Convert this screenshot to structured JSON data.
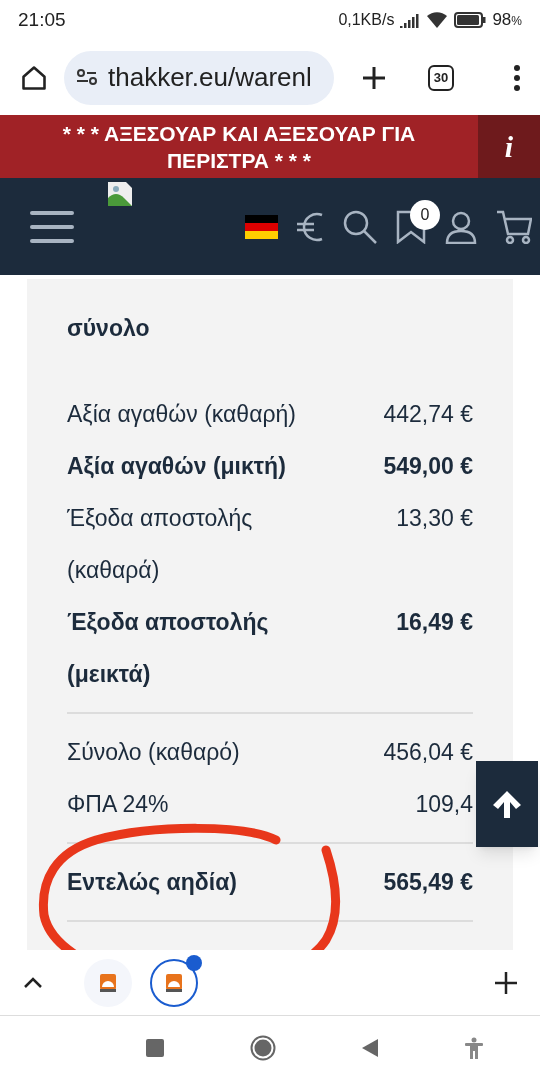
{
  "status_bar": {
    "time": "21:05",
    "speed": "0,1KB/s",
    "battery": "98",
    "battery_unit": "%"
  },
  "browser": {
    "url": "thakker.eu/warenl",
    "tab_count": "30"
  },
  "banner": {
    "text": "* * * ΑΞΕΣΟΥΑΡ ΚΑΙ ΑΞΕΣΟΥΑΡ ΓΙΑ ΠΕΡΙΣΤΡΑ * * *",
    "info": "i"
  },
  "header": {
    "wishlist_count": "0"
  },
  "summary": {
    "title": "σύνολο",
    "rows": [
      {
        "label": "Αξία αγαθών (καθαρή)",
        "value": "442,74 €",
        "bold": false,
        "divider_after": false
      },
      {
        "label": "Αξία αγαθών (μικτή)",
        "value": "549,00 €",
        "bold": true,
        "divider_after": false
      },
      {
        "label": "Έξοδα αποστολής (καθαρά)",
        "value": "13,30 €",
        "bold": false,
        "divider_after": false
      },
      {
        "label": "Έξοδα αποστολής (μεικτά)",
        "value": "16,49 €",
        "bold": true,
        "divider_after": true
      },
      {
        "label": "Σύνολο (καθαρό)",
        "value": "456,04 €",
        "bold": false,
        "divider_after": false
      },
      {
        "label": "ΦΠΑ 24%",
        "value": "109,4",
        "bold": false,
        "divider_after": true
      },
      {
        "label": "Εντελώς αηδία)",
        "value": "565,49 €",
        "bold": true,
        "divider_after": true
      }
    ]
  },
  "tab_strip": {
    "tabs": [
      {
        "selected": false
      },
      {
        "selected": true
      }
    ]
  }
}
